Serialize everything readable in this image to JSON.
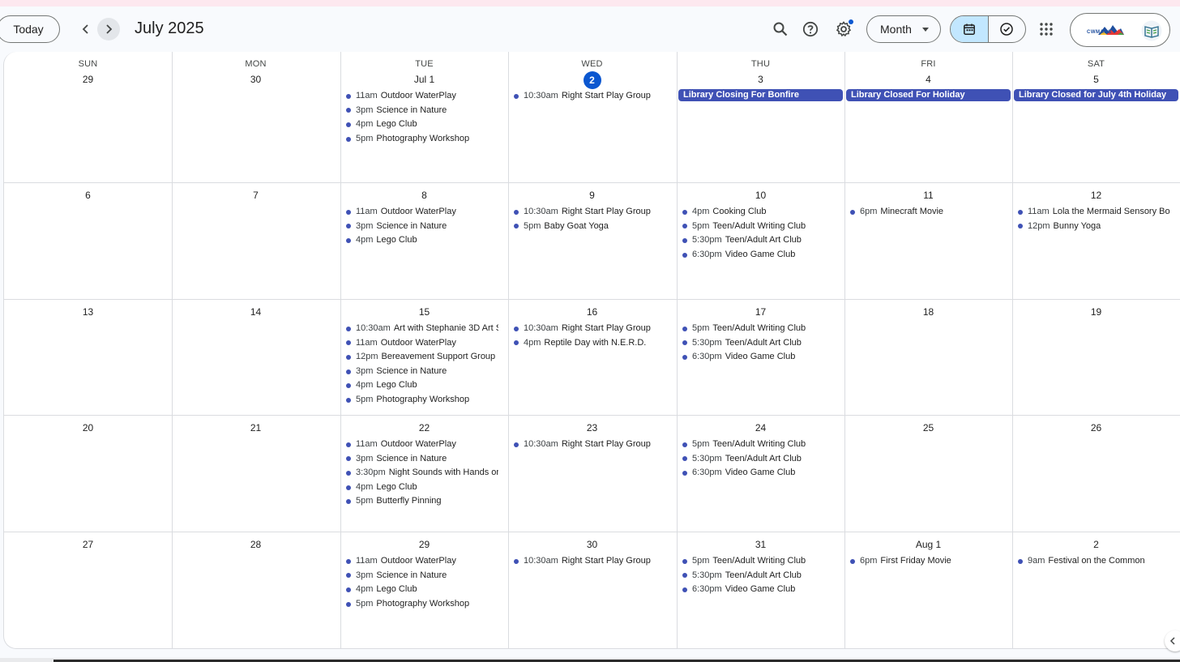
{
  "header": {
    "today_label": "Today",
    "month_title": "July 2025",
    "view_label": "Month",
    "logo_text": "CWMARS"
  },
  "colors": {
    "event_dot": "#3f51b5",
    "today_circle": "#0b57d0",
    "selected_segment": "#c2e7ff"
  },
  "icons": [
    "chevron-left-icon",
    "chevron-right-icon",
    "search-icon",
    "help-icon",
    "settings-icon",
    "calendar-icon",
    "task-check-icon",
    "apps-grid-icon",
    "book-icon"
  ],
  "calendar": {
    "weekdays": [
      "SUN",
      "MON",
      "TUE",
      "WED",
      "THU",
      "FRI",
      "SAT"
    ],
    "weeks": [
      {
        "days": [
          {
            "label": "29",
            "events": []
          },
          {
            "label": "30",
            "events": []
          },
          {
            "label": "Jul 1",
            "events": [
              {
                "time": "11am",
                "title": "Outdoor WaterPlay"
              },
              {
                "time": "3pm",
                "title": "Science in Nature"
              },
              {
                "time": "4pm",
                "title": "Lego Club"
              },
              {
                "time": "5pm",
                "title": "Photography Workshop"
              }
            ]
          },
          {
            "label": "2",
            "today": true,
            "events": [
              {
                "time": "10:30am",
                "title": "Right Start Play Group"
              }
            ]
          },
          {
            "label": "3",
            "events": [
              {
                "allday": true,
                "title": "Library Closing For Bonfire"
              }
            ]
          },
          {
            "label": "4",
            "events": [
              {
                "allday": true,
                "title": "Library Closed For Holiday"
              }
            ]
          },
          {
            "label": "5",
            "events": [
              {
                "allday": true,
                "title": "Library Closed for July 4th Holiday"
              }
            ]
          }
        ]
      },
      {
        "days": [
          {
            "label": "6",
            "events": []
          },
          {
            "label": "7",
            "events": []
          },
          {
            "label": "8",
            "events": [
              {
                "time": "11am",
                "title": "Outdoor WaterPlay"
              },
              {
                "time": "3pm",
                "title": "Science in Nature"
              },
              {
                "time": "4pm",
                "title": "Lego Club"
              }
            ]
          },
          {
            "label": "9",
            "events": [
              {
                "time": "10:30am",
                "title": "Right Start Play Group"
              },
              {
                "time": "5pm",
                "title": "Baby Goat Yoga"
              }
            ]
          },
          {
            "label": "10",
            "events": [
              {
                "time": "4pm",
                "title": "Cooking Club"
              },
              {
                "time": "5pm",
                "title": "Teen/Adult Writing Club"
              },
              {
                "time": "5:30pm",
                "title": "Teen/Adult Art Club"
              },
              {
                "time": "6:30pm",
                "title": "Video Game Club"
              }
            ]
          },
          {
            "label": "11",
            "events": [
              {
                "time": "6pm",
                "title": "Minecraft Movie"
              }
            ]
          },
          {
            "label": "12",
            "events": [
              {
                "time": "11am",
                "title": "Lola the Mermaid Sensory Box"
              },
              {
                "time": "12pm",
                "title": "Bunny Yoga"
              }
            ]
          }
        ]
      },
      {
        "days": [
          {
            "label": "13",
            "events": []
          },
          {
            "label": "14",
            "events": []
          },
          {
            "label": "15",
            "events": [
              {
                "time": "10:30am",
                "title": "Art with Stephanie 3D Art S"
              },
              {
                "time": "11am",
                "title": "Outdoor WaterPlay"
              },
              {
                "time": "12pm",
                "title": "Bereavement Support Group"
              },
              {
                "time": "3pm",
                "title": "Science in Nature"
              },
              {
                "time": "4pm",
                "title": "Lego Club"
              },
              {
                "time": "5pm",
                "title": "Photography Workshop"
              }
            ]
          },
          {
            "label": "16",
            "events": [
              {
                "time": "10:30am",
                "title": "Right Start Play Group"
              },
              {
                "time": "4pm",
                "title": "Reptile Day with N.E.R.D."
              }
            ]
          },
          {
            "label": "17",
            "events": [
              {
                "time": "5pm",
                "title": "Teen/Adult Writing Club"
              },
              {
                "time": "5:30pm",
                "title": "Teen/Adult Art Club"
              },
              {
                "time": "6:30pm",
                "title": "Video Game Club"
              }
            ]
          },
          {
            "label": "18",
            "events": []
          },
          {
            "label": "19",
            "events": []
          }
        ]
      },
      {
        "days": [
          {
            "label": "20",
            "events": []
          },
          {
            "label": "21",
            "events": []
          },
          {
            "label": "22",
            "events": [
              {
                "time": "11am",
                "title": "Outdoor WaterPlay"
              },
              {
                "time": "3pm",
                "title": "Science in Nature"
              },
              {
                "time": "3:30pm",
                "title": "Night Sounds with Hands or"
              },
              {
                "time": "4pm",
                "title": "Lego Club"
              },
              {
                "time": "5pm",
                "title": "Butterfly Pinning"
              }
            ]
          },
          {
            "label": "23",
            "events": [
              {
                "time": "10:30am",
                "title": "Right Start Play Group"
              }
            ]
          },
          {
            "label": "24",
            "events": [
              {
                "time": "5pm",
                "title": "Teen/Adult Writing Club"
              },
              {
                "time": "5:30pm",
                "title": "Teen/Adult Art Club"
              },
              {
                "time": "6:30pm",
                "title": "Video Game Club"
              }
            ]
          },
          {
            "label": "25",
            "events": []
          },
          {
            "label": "26",
            "events": []
          }
        ]
      },
      {
        "days": [
          {
            "label": "27",
            "events": []
          },
          {
            "label": "28",
            "events": []
          },
          {
            "label": "29",
            "events": [
              {
                "time": "11am",
                "title": "Outdoor WaterPlay"
              },
              {
                "time": "3pm",
                "title": "Science in Nature"
              },
              {
                "time": "4pm",
                "title": "Lego Club"
              },
              {
                "time": "5pm",
                "title": "Photography Workshop"
              }
            ]
          },
          {
            "label": "30",
            "events": [
              {
                "time": "10:30am",
                "title": "Right Start Play Group"
              }
            ]
          },
          {
            "label": "31",
            "events": [
              {
                "time": "5pm",
                "title": "Teen/Adult Writing Club"
              },
              {
                "time": "5:30pm",
                "title": "Teen/Adult Art Club"
              },
              {
                "time": "6:30pm",
                "title": "Video Game Club"
              }
            ]
          },
          {
            "label": "Aug 1",
            "events": [
              {
                "time": "6pm",
                "title": "First Friday Movie"
              }
            ]
          },
          {
            "label": "2",
            "events": [
              {
                "time": "9am",
                "title": "Festival on the Common"
              }
            ]
          }
        ]
      }
    ]
  }
}
